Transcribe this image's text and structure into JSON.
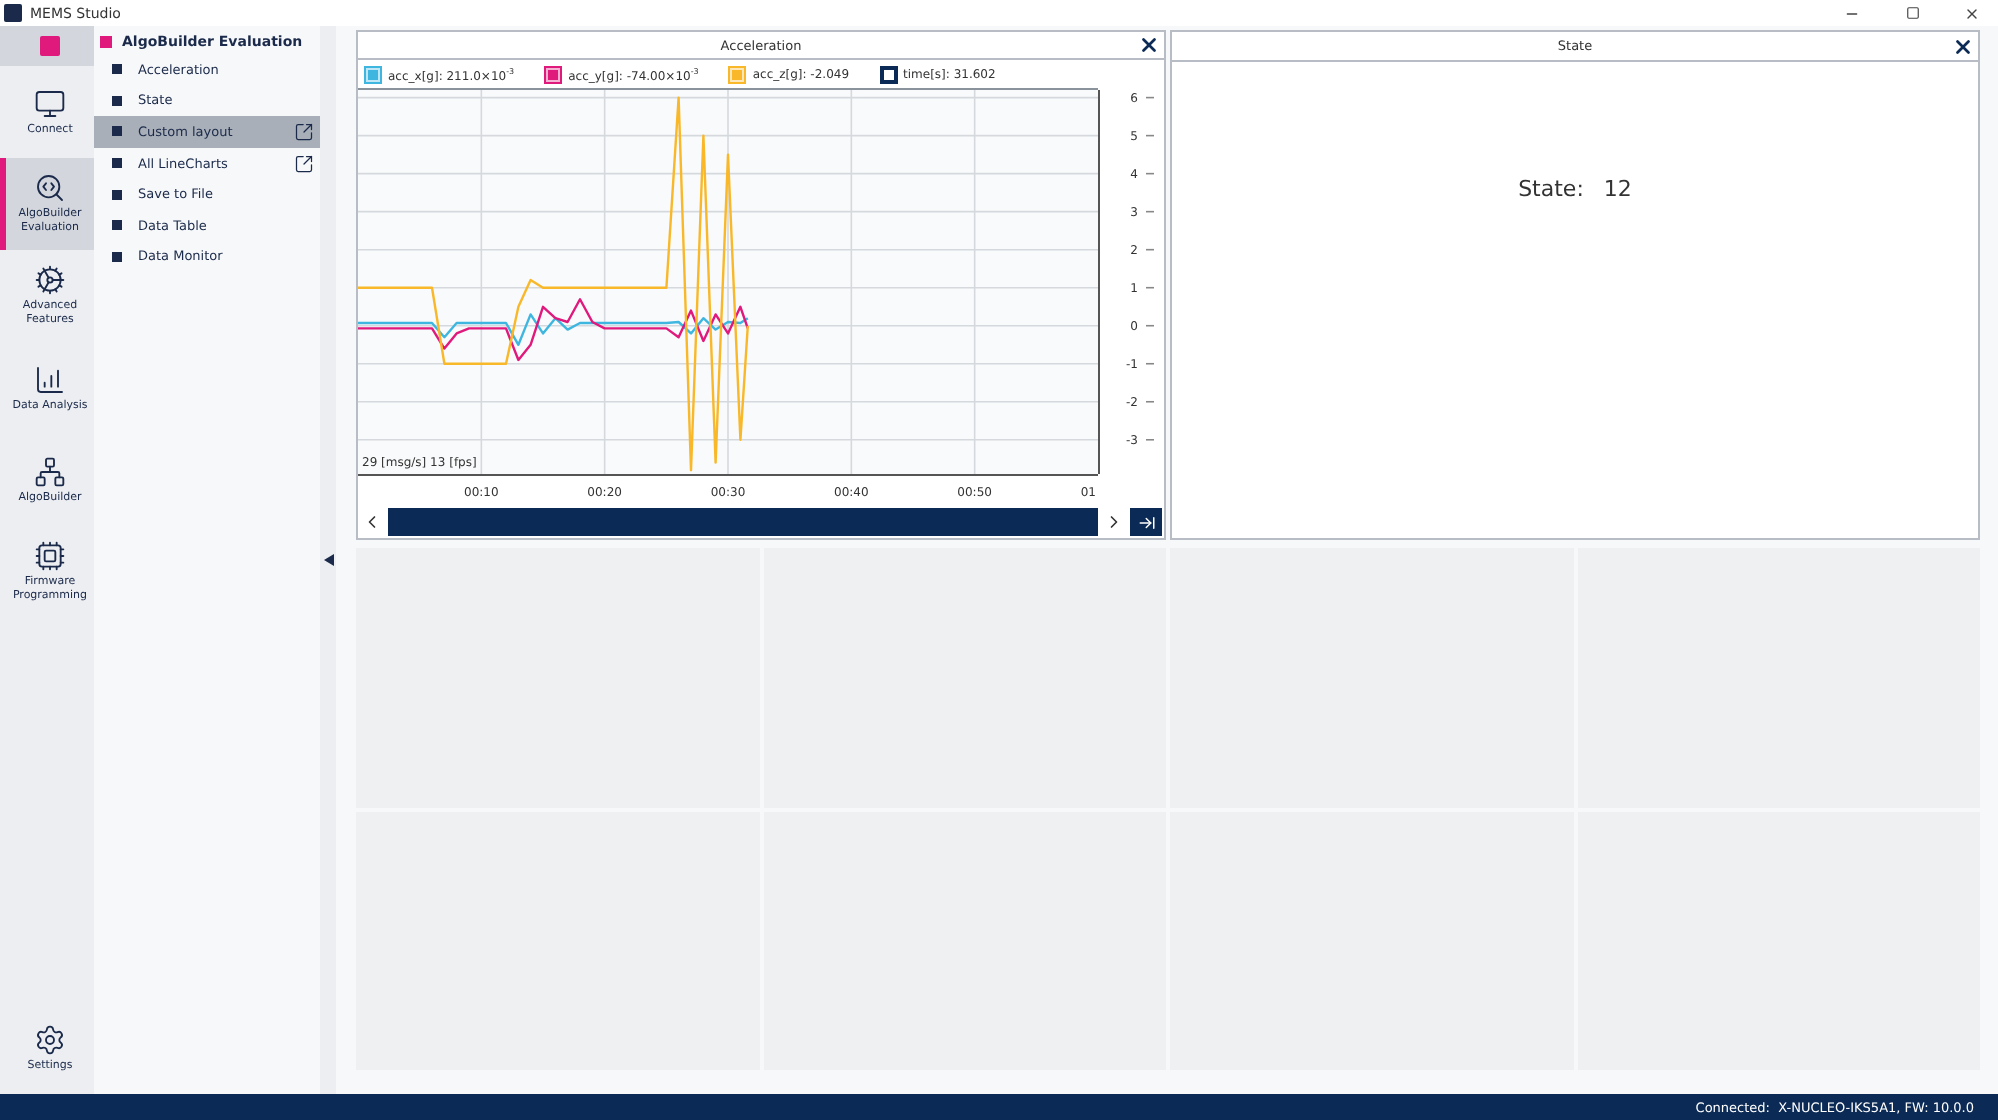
{
  "window": {
    "title": "MEMS Studio"
  },
  "rail": [
    {
      "kind": "brand",
      "selected": false
    },
    {
      "kind": "connect",
      "label": "Connect",
      "selected": false
    },
    {
      "kind": "evaluation",
      "label": "AlgoBuilder Evaluation",
      "selected": true
    },
    {
      "kind": "advanced",
      "label": "Advanced Features",
      "selected": false
    },
    {
      "kind": "analysis",
      "label": "Data Analysis",
      "selected": false
    },
    {
      "kind": "algobuilder",
      "label": "AlgoBuilder",
      "selected": false
    },
    {
      "kind": "firmware",
      "label": "Firmware Programming",
      "selected": false
    },
    {
      "kind": "settings",
      "label": "Settings",
      "selected": false
    }
  ],
  "sidebar": {
    "title": "AlgoBuilder Evaluation",
    "items": [
      {
        "label": "Acceleration",
        "selected": false,
        "external": false
      },
      {
        "label": "State",
        "selected": false,
        "external": false
      },
      {
        "label": "Custom layout",
        "selected": true,
        "external": true
      },
      {
        "label": "All LineCharts",
        "selected": false,
        "external": true
      },
      {
        "label": "Save to File",
        "selected": false,
        "external": false
      },
      {
        "label": "Data Table",
        "selected": false,
        "external": false
      },
      {
        "label": "Data Monitor",
        "selected": false,
        "external": false
      }
    ]
  },
  "acceleration": {
    "title": "Acceleration",
    "legend": [
      {
        "value": ": 211.0×10$^{-3}$",
        "kind": "filled"
      },
      {
        "value": ": -74.00×10$^{-3}$",
        "kind": "filled"
      },
      {
        "value": ": -2.049",
        "kind": "filled"
      },
      {
        "name": "time[s]",
        "value": ": 31.602",
        "color": "#0b2a55",
        "kind": "outline"
      }
    ],
    "x_edge_label": "01",
    "rate": "29 [msg/s] 13 [fps]",
    "chart_data": {
      "type": "line",
      "x": [
        0,
        1,
        2,
        3,
        4,
        5,
        6,
        7,
        8,
        9,
        10,
        11,
        12,
        13,
        14,
        15,
        16,
        17,
        18,
        19,
        20,
        21,
        22,
        23,
        24,
        25,
        26,
        27,
        28,
        29,
        30,
        31,
        31.6
      ],
      "series": [
        {
          "name": "acc_x[g]",
          "color": "#3fb6e0",
          "values": [
            0.07,
            0.07,
            0.07,
            0.07,
            0.07,
            0.07,
            0.07,
            -0.3,
            0.07,
            0.07,
            0.07,
            0.07,
            0.07,
            -0.5,
            0.3,
            -0.2,
            0.2,
            -0.1,
            0.07,
            0.07,
            0.07,
            0.07,
            0.07,
            0.07,
            0.07,
            0.07,
            0.1,
            -0.2,
            0.2,
            -0.1,
            0.1,
            0.07,
            0.2
          ]
        },
        {
          "name": "acc_y[g]",
          "color": "#e0197d",
          "values": [
            -0.07,
            -0.07,
            -0.07,
            -0.07,
            -0.07,
            -0.07,
            -0.07,
            -0.6,
            -0.2,
            -0.07,
            -0.07,
            -0.07,
            -0.07,
            -0.9,
            -0.5,
            0.5,
            0.2,
            0.1,
            0.7,
            0.1,
            -0.07,
            -0.07,
            -0.07,
            -0.07,
            -0.07,
            -0.07,
            -0.3,
            0.4,
            -0.4,
            0.3,
            -0.2,
            0.5,
            -0.07
          ]
        },
        {
          "name": "acc_z[g]",
          "color": "#f8b82a",
          "values": [
            1,
            1,
            1,
            1,
            1,
            1,
            1,
            -1,
            -1,
            -1,
            -1,
            -1,
            -1,
            0.5,
            1.2,
            1,
            1,
            1,
            1,
            1,
            1,
            1,
            1,
            1,
            1,
            1,
            6,
            -3.8,
            5,
            -3.6,
            4.5,
            -3,
            0
          ]
        }
      ],
      "xlim": [
        0,
        60
      ],
      "grid": true,
      "ylim": [
        -3.9,
        6.2
      ],
      "xticks": [
        {
          "value": 10,
          "label": "00:10"
        },
        {
          "value": 20,
          "label": "00:20"
        },
        {
          "value": 30,
          "label": "00:30"
        },
        {
          "value": 40,
          "label": "00:40"
        },
        {
          "value": 50,
          "label": "00:50"
        }
      ],
      "yticks": [
        -3,
        -2,
        -1,
        0,
        1,
        2,
        3,
        4,
        5,
        6
      ]
    }
  },
  "state_panel": {
    "title": "State",
    "label": "State:",
    "value": "12"
  },
  "status_bar": "Connected:  X-NUCLEO-IKS5A1, FW: 10.0.0"
}
